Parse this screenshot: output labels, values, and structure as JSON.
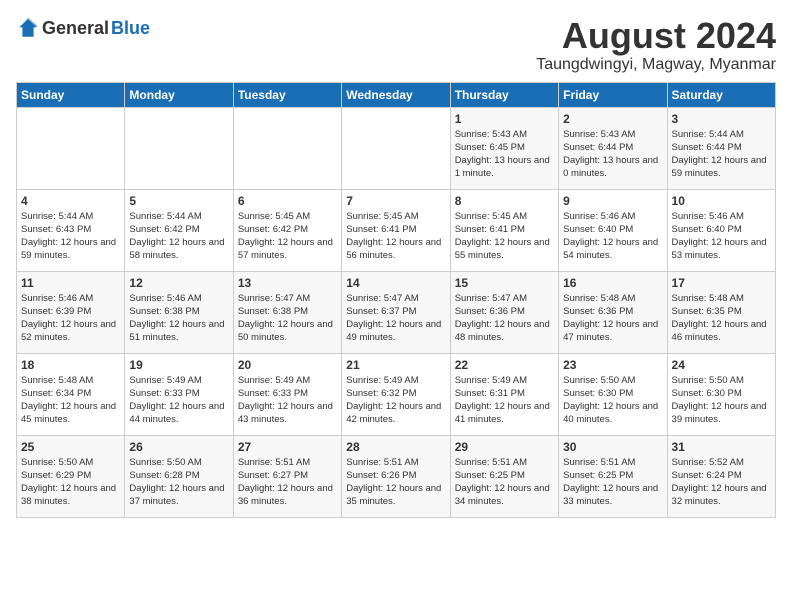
{
  "logo": {
    "general": "General",
    "blue": "Blue"
  },
  "calendar": {
    "title": "August 2024",
    "subtitle": "Taungdwingyi, Magway, Myanmar"
  },
  "weekdays": [
    "Sunday",
    "Monday",
    "Tuesday",
    "Wednesday",
    "Thursday",
    "Friday",
    "Saturday"
  ],
  "weeks": [
    [
      {
        "day": "",
        "info": ""
      },
      {
        "day": "",
        "info": ""
      },
      {
        "day": "",
        "info": ""
      },
      {
        "day": "",
        "info": ""
      },
      {
        "day": "1",
        "info": "Sunrise: 5:43 AM\nSunset: 6:45 PM\nDaylight: 13 hours and 1 minute."
      },
      {
        "day": "2",
        "info": "Sunrise: 5:43 AM\nSunset: 6:44 PM\nDaylight: 13 hours and 0 minutes."
      },
      {
        "day": "3",
        "info": "Sunrise: 5:44 AM\nSunset: 6:44 PM\nDaylight: 12 hours and 59 minutes."
      }
    ],
    [
      {
        "day": "4",
        "info": "Sunrise: 5:44 AM\nSunset: 6:43 PM\nDaylight: 12 hours and 59 minutes."
      },
      {
        "day": "5",
        "info": "Sunrise: 5:44 AM\nSunset: 6:42 PM\nDaylight: 12 hours and 58 minutes."
      },
      {
        "day": "6",
        "info": "Sunrise: 5:45 AM\nSunset: 6:42 PM\nDaylight: 12 hours and 57 minutes."
      },
      {
        "day": "7",
        "info": "Sunrise: 5:45 AM\nSunset: 6:41 PM\nDaylight: 12 hours and 56 minutes."
      },
      {
        "day": "8",
        "info": "Sunrise: 5:45 AM\nSunset: 6:41 PM\nDaylight: 12 hours and 55 minutes."
      },
      {
        "day": "9",
        "info": "Sunrise: 5:46 AM\nSunset: 6:40 PM\nDaylight: 12 hours and 54 minutes."
      },
      {
        "day": "10",
        "info": "Sunrise: 5:46 AM\nSunset: 6:40 PM\nDaylight: 12 hours and 53 minutes."
      }
    ],
    [
      {
        "day": "11",
        "info": "Sunrise: 5:46 AM\nSunset: 6:39 PM\nDaylight: 12 hours and 52 minutes."
      },
      {
        "day": "12",
        "info": "Sunrise: 5:46 AM\nSunset: 6:38 PM\nDaylight: 12 hours and 51 minutes."
      },
      {
        "day": "13",
        "info": "Sunrise: 5:47 AM\nSunset: 6:38 PM\nDaylight: 12 hours and 50 minutes."
      },
      {
        "day": "14",
        "info": "Sunrise: 5:47 AM\nSunset: 6:37 PM\nDaylight: 12 hours and 49 minutes."
      },
      {
        "day": "15",
        "info": "Sunrise: 5:47 AM\nSunset: 6:36 PM\nDaylight: 12 hours and 48 minutes."
      },
      {
        "day": "16",
        "info": "Sunrise: 5:48 AM\nSunset: 6:36 PM\nDaylight: 12 hours and 47 minutes."
      },
      {
        "day": "17",
        "info": "Sunrise: 5:48 AM\nSunset: 6:35 PM\nDaylight: 12 hours and 46 minutes."
      }
    ],
    [
      {
        "day": "18",
        "info": "Sunrise: 5:48 AM\nSunset: 6:34 PM\nDaylight: 12 hours and 45 minutes."
      },
      {
        "day": "19",
        "info": "Sunrise: 5:49 AM\nSunset: 6:33 PM\nDaylight: 12 hours and 44 minutes."
      },
      {
        "day": "20",
        "info": "Sunrise: 5:49 AM\nSunset: 6:33 PM\nDaylight: 12 hours and 43 minutes."
      },
      {
        "day": "21",
        "info": "Sunrise: 5:49 AM\nSunset: 6:32 PM\nDaylight: 12 hours and 42 minutes."
      },
      {
        "day": "22",
        "info": "Sunrise: 5:49 AM\nSunset: 6:31 PM\nDaylight: 12 hours and 41 minutes."
      },
      {
        "day": "23",
        "info": "Sunrise: 5:50 AM\nSunset: 6:30 PM\nDaylight: 12 hours and 40 minutes."
      },
      {
        "day": "24",
        "info": "Sunrise: 5:50 AM\nSunset: 6:30 PM\nDaylight: 12 hours and 39 minutes."
      }
    ],
    [
      {
        "day": "25",
        "info": "Sunrise: 5:50 AM\nSunset: 6:29 PM\nDaylight: 12 hours and 38 minutes."
      },
      {
        "day": "26",
        "info": "Sunrise: 5:50 AM\nSunset: 6:28 PM\nDaylight: 12 hours and 37 minutes."
      },
      {
        "day": "27",
        "info": "Sunrise: 5:51 AM\nSunset: 6:27 PM\nDaylight: 12 hours and 36 minutes."
      },
      {
        "day": "28",
        "info": "Sunrise: 5:51 AM\nSunset: 6:26 PM\nDaylight: 12 hours and 35 minutes."
      },
      {
        "day": "29",
        "info": "Sunrise: 5:51 AM\nSunset: 6:25 PM\nDaylight: 12 hours and 34 minutes."
      },
      {
        "day": "30",
        "info": "Sunrise: 5:51 AM\nSunset: 6:25 PM\nDaylight: 12 hours and 33 minutes."
      },
      {
        "day": "31",
        "info": "Sunrise: 5:52 AM\nSunset: 6:24 PM\nDaylight: 12 hours and 32 minutes."
      }
    ]
  ]
}
